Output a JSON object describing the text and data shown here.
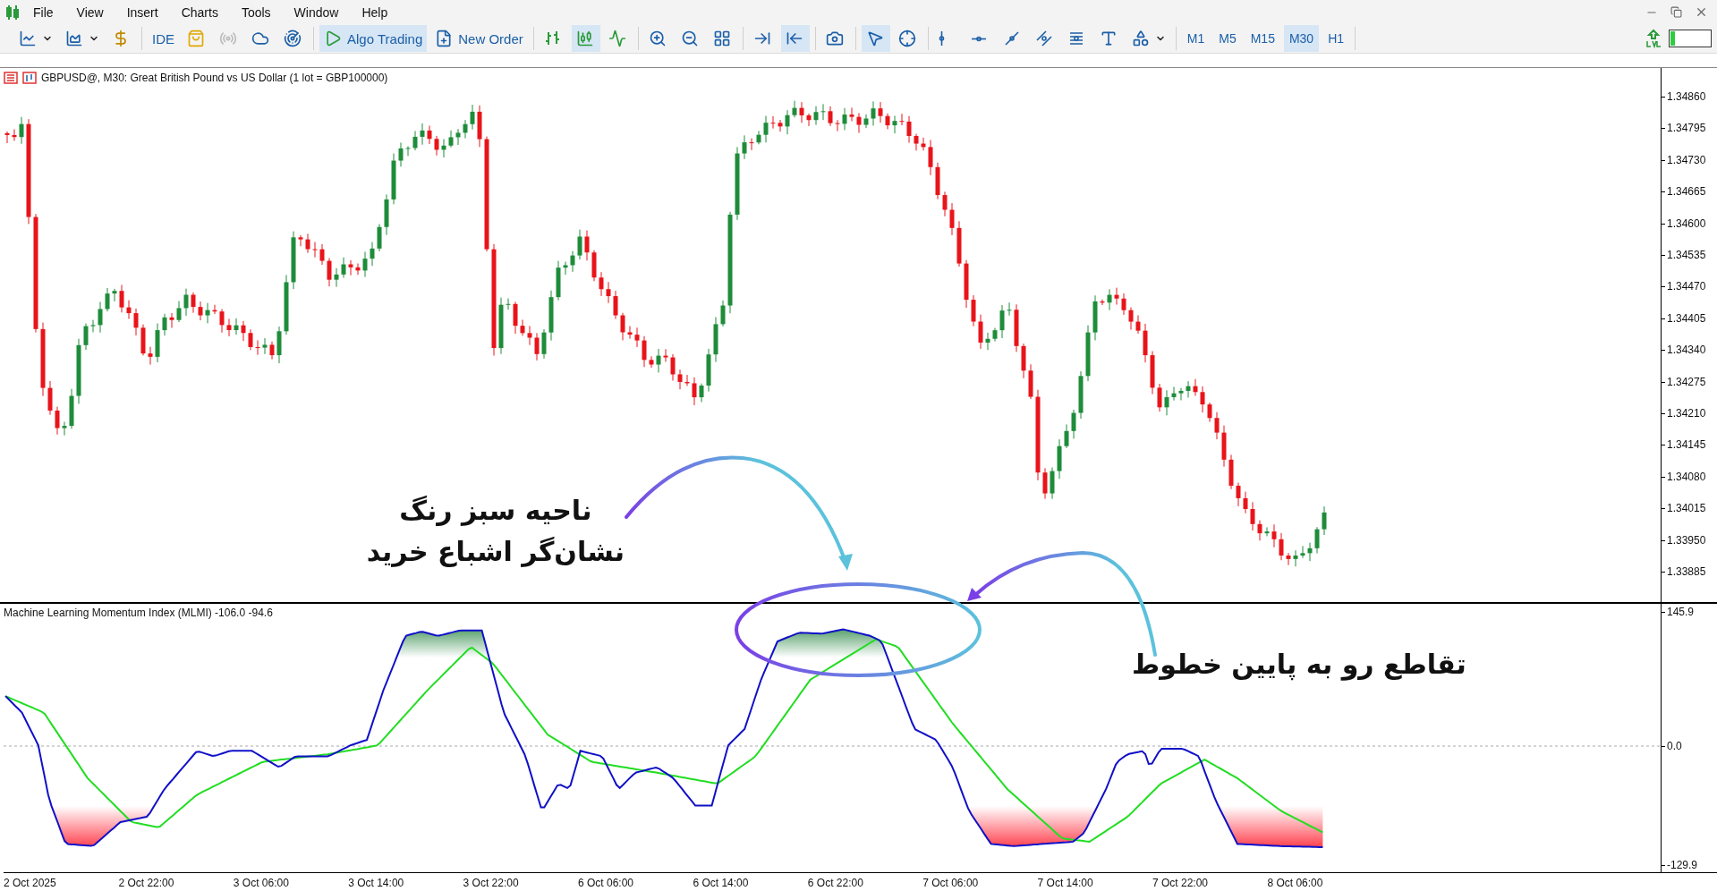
{
  "menu": [
    {
      "label": "File"
    },
    {
      "label": "View"
    },
    {
      "label": "Insert"
    },
    {
      "label": "Charts"
    },
    {
      "label": "Tools"
    },
    {
      "label": "Window"
    },
    {
      "label": "Help"
    }
  ],
  "toolbar": {
    "groups": [
      [
        {
          "kind": "line-chart",
          "dropdown": true,
          "active": false,
          "disabled": false
        },
        {
          "kind": "area-chart",
          "dropdown": true,
          "active": false,
          "disabled": false
        },
        {
          "kind": "dollar",
          "dropdown": false,
          "active": false,
          "disabled": false
        }
      ],
      [
        {
          "kind": "ide",
          "label": "IDE",
          "dropdown": false,
          "active": false,
          "disabled": false
        },
        {
          "kind": "bag",
          "dropdown": false,
          "active": false,
          "disabled": false
        },
        {
          "kind": "radio",
          "dropdown": false,
          "active": false,
          "disabled": true
        },
        {
          "kind": "cloud",
          "dropdown": false,
          "active": false,
          "disabled": false
        },
        {
          "kind": "radar",
          "dropdown": false,
          "active": false,
          "disabled": false
        }
      ],
      [
        {
          "kind": "algo",
          "label": "Algo Trading",
          "dropdown": false,
          "active": true,
          "disabled": false
        },
        {
          "kind": "order",
          "label": "New Order",
          "dropdown": false,
          "active": false,
          "disabled": false
        }
      ],
      [
        {
          "kind": "bars",
          "dropdown": false,
          "active": false,
          "disabled": false
        },
        {
          "kind": "candles",
          "dropdown": false,
          "active": true,
          "disabled": false
        },
        {
          "kind": "zigzag",
          "dropdown": false,
          "active": false,
          "disabled": false
        }
      ],
      [
        {
          "kind": "zoom-in",
          "dropdown": false,
          "active": false,
          "disabled": false
        },
        {
          "kind": "zoom-out",
          "dropdown": false,
          "active": false,
          "disabled": false
        },
        {
          "kind": "grid",
          "dropdown": false,
          "active": false,
          "disabled": false
        }
      ],
      [
        {
          "kind": "shift",
          "dropdown": false,
          "active": false,
          "disabled": false
        },
        {
          "kind": "autoscroll",
          "dropdown": false,
          "active": true,
          "disabled": false
        }
      ],
      [
        {
          "kind": "camera",
          "dropdown": false,
          "active": false,
          "disabled": false
        }
      ],
      [
        {
          "kind": "cursor",
          "dropdown": false,
          "active": true,
          "disabled": false
        },
        {
          "kind": "crosshair",
          "dropdown": false,
          "active": false,
          "disabled": false
        }
      ],
      [
        {
          "kind": "vline",
          "dropdown": false,
          "active": false,
          "disabled": false
        },
        {
          "kind": "hline",
          "dropdown": false,
          "active": false,
          "disabled": false
        },
        {
          "kind": "trendline",
          "dropdown": false,
          "active": false,
          "disabled": false
        },
        {
          "kind": "channel",
          "dropdown": false,
          "active": false,
          "disabled": false
        },
        {
          "kind": "fibo",
          "dropdown": false,
          "active": false,
          "disabled": false
        },
        {
          "kind": "text",
          "dropdown": false,
          "active": false,
          "disabled": false
        },
        {
          "kind": "shapes",
          "dropdown": true,
          "active": false,
          "disabled": false
        }
      ]
    ]
  },
  "timeframes": [
    {
      "label": "M1",
      "selected": false
    },
    {
      "label": "M5",
      "selected": false
    },
    {
      "label": "M15",
      "selected": false
    },
    {
      "label": "M30",
      "selected": true
    },
    {
      "label": "H1",
      "selected": false
    }
  ],
  "chart": {
    "title": "GBPUSD@, M30:  Great British Pound vs US Dollar (1 lot = GBP100000)",
    "price_labels": [
      "1.34860",
      "1.34795",
      "1.34730",
      "1.34665",
      "1.34600",
      "1.34535",
      "1.34470",
      "1.34405",
      "1.34340",
      "1.34275",
      "1.34210",
      "1.34145",
      "1.34080",
      "1.34015",
      "1.33950",
      "1.33885"
    ]
  },
  "indicator": {
    "title": "Machine Learning Momentum Index (MLMI) -106.0 -94.6",
    "axis_labels": [
      "145.9",
      "0.0",
      "-129.9"
    ]
  },
  "time_labels": [
    "2 Oct 2025",
    "2 Oct 22:00",
    "3 Oct 06:00",
    "3 Oct 14:00",
    "3 Oct 22:00",
    "6 Oct 06:00",
    "6 Oct 14:00",
    "6 Oct 22:00",
    "7 Oct 06:00",
    "7 Oct 14:00",
    "7 Oct 22:00",
    "8 Oct 06:00"
  ],
  "callouts": [
    {
      "lines": [
        "ناحیه سبز رنگ",
        "نشان‌گر اشباع خرید"
      ]
    },
    {
      "lines": [
        "تقاطع رو به پایین خطوط"
      ]
    }
  ]
}
